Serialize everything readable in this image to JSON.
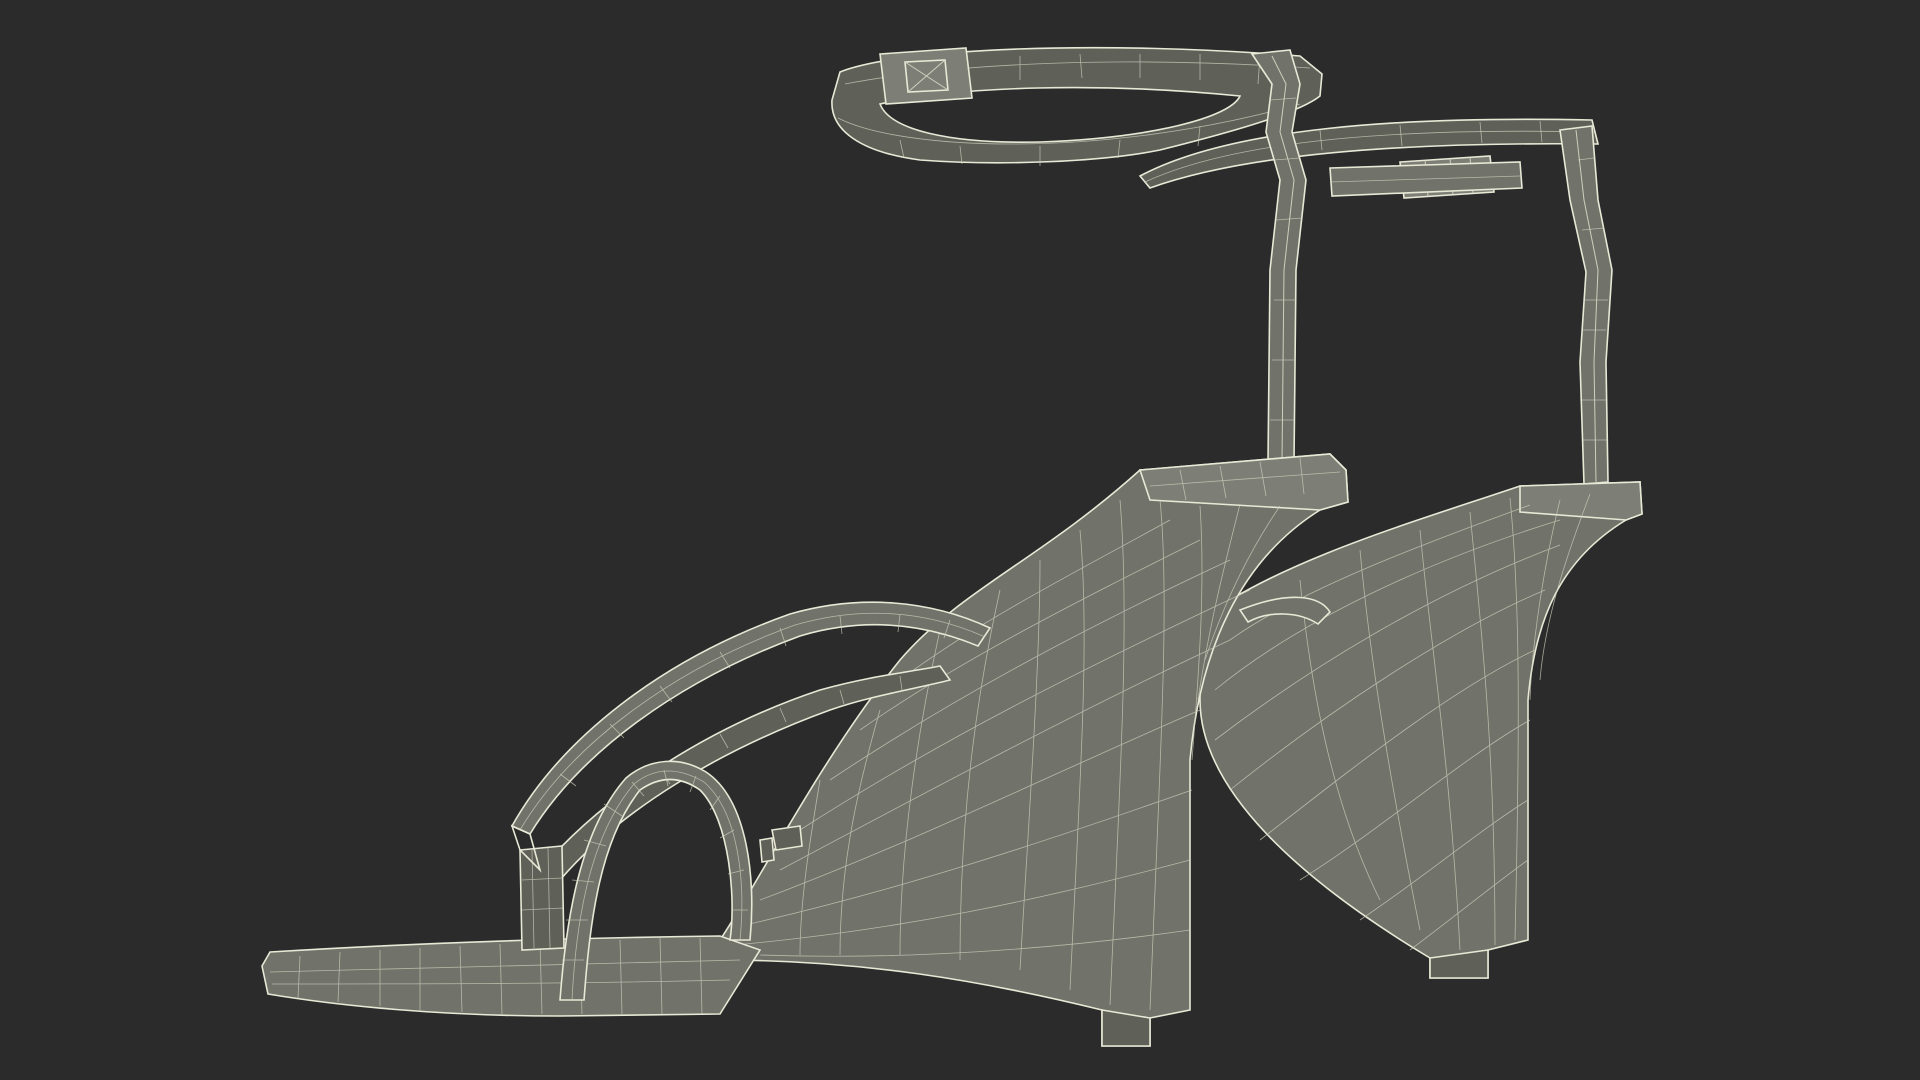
{
  "scene": {
    "subject": "wireframe-wedge-sandals",
    "background_color": "#2b2b2b",
    "mesh_color": "#71736a",
    "wire_color": "#e8e8d6"
  }
}
